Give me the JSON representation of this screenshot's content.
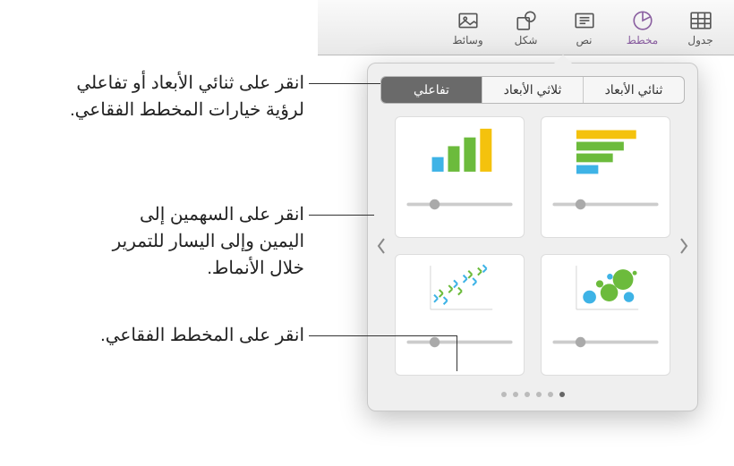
{
  "toolbar": {
    "items": [
      {
        "name": "table",
        "label": "جدول"
      },
      {
        "name": "chart",
        "label": "مخطط"
      },
      {
        "name": "text",
        "label": "نص"
      },
      {
        "name": "shape",
        "label": "شكل"
      },
      {
        "name": "media",
        "label": "وسائط"
      }
    ],
    "activeIndex": 1
  },
  "segments": {
    "items": [
      {
        "label": "ثنائي الأبعاد"
      },
      {
        "label": "ثلاثي الأبعاد"
      },
      {
        "label": "تفاعلي"
      }
    ],
    "selectedIndex": 2
  },
  "charts": [
    {
      "name": "horizontal-bar-chart"
    },
    {
      "name": "vertical-bar-chart"
    },
    {
      "name": "bubble-chart"
    },
    {
      "name": "scatter-chart"
    }
  ],
  "pageDots": {
    "count": 6,
    "activeIndex": 5
  },
  "callouts": {
    "c1": "انقر على ثنائي الأبعاد أو تفاعلي لرؤية خيارات المخطط الفقاعي.",
    "c2": "انقر على السهمين إلى اليمين وإلى اليسار للتمرير خلال الأنماط.",
    "c3": "انقر على المخطط الفقاعي."
  },
  "colors": {
    "accentBlue": "#3eb3e6",
    "accentGreen": "#6cbb3c",
    "accentYellow": "#f4c20d"
  }
}
